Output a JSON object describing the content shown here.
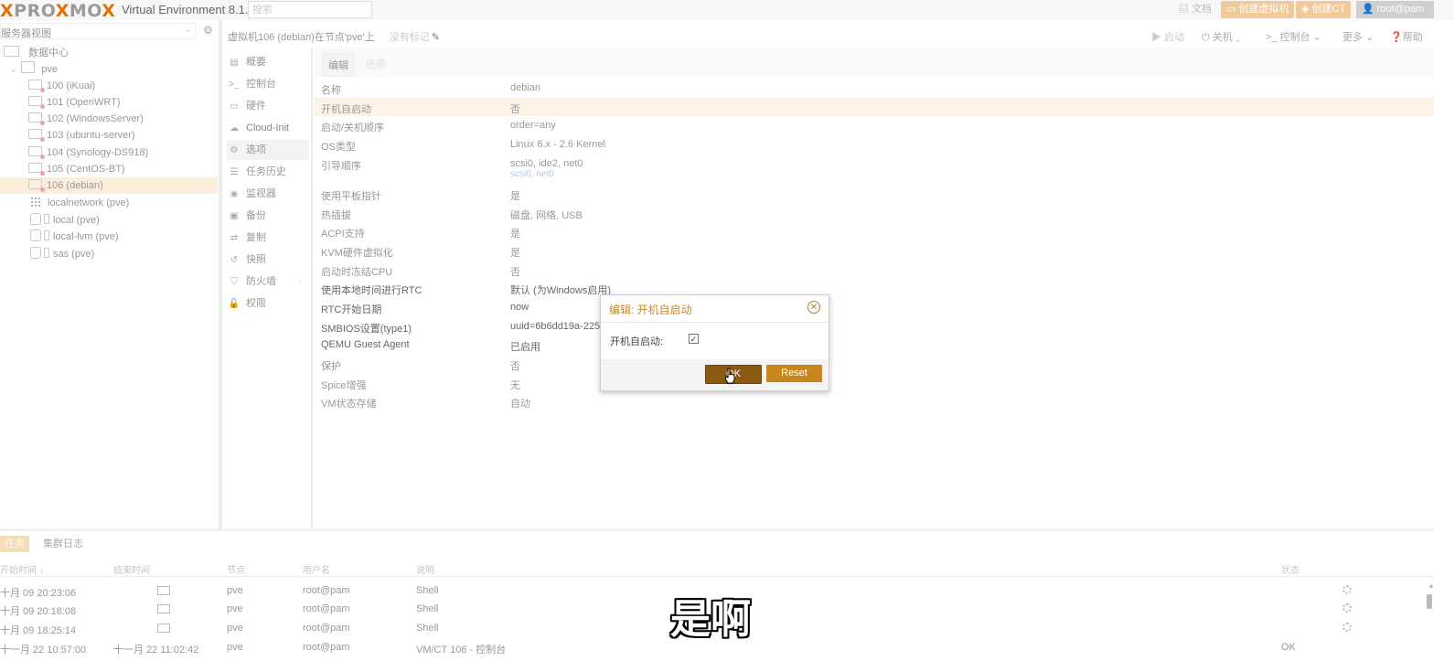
{
  "topbar": {
    "logo_a": "PRO",
    "logo_x1": "X",
    "logo_b": "MO",
    "logo_x2": "X",
    "version": "Virtual Environment 8.1.4",
    "search_placeholder": "搜索",
    "docs": "文档",
    "create_vm": "创建虚拟机",
    "create_ct": "创建CT",
    "user": "root@pam"
  },
  "tree": {
    "view": "服务器视图",
    "datacenter": "数据中心",
    "node": "pve",
    "vms": [
      "100 (iKuai)",
      "101 (OpenWRT)",
      "102 (WindowsServer)",
      "103 (ubuntu-server)",
      "104 (Synology-DS918)",
      "105 (CentOS-BT)",
      "106 (debian)"
    ],
    "network": "localnetwork (pve)",
    "storages": [
      "local (pve)",
      "local-lvm (pve)",
      "sas (pve)"
    ]
  },
  "header": {
    "title": "虚拟机106 (debian)在节点'pve'上",
    "tags": "没有标记",
    "start": "启动",
    "shutdown": "关机",
    "console": "控制台",
    "more": "更多",
    "help": "帮助"
  },
  "nav": [
    "概要",
    "控制台",
    "硬件",
    "Cloud-Init",
    "选项",
    "任务历史",
    "监视器",
    "备份",
    "复制",
    "快照",
    "防火墙",
    "权限"
  ],
  "options": {
    "edit": "编辑",
    "revert": "还原",
    "rows": [
      {
        "label": "名称",
        "value": "debian"
      },
      {
        "label": "开机自启动",
        "value": "否"
      },
      {
        "label": "启动/关机顺序",
        "value": "order=any"
      },
      {
        "label": "OS类型",
        "value": "Linux 6.x - 2.6 Kernel"
      },
      {
        "label": "引导顺序",
        "value": "scsi0, ide2, net0",
        "value2": "scsi0, net0"
      },
      {
        "label": "使用平板指针",
        "value": "是"
      },
      {
        "label": "热插拔",
        "value": "磁盘, 网络, USB"
      },
      {
        "label": "ACPI支持",
        "value": "是"
      },
      {
        "label": "KVM硬件虚拟化",
        "value": "是"
      },
      {
        "label": "启动时冻结CPU",
        "value": "否"
      },
      {
        "label": "使用本地时间进行RTC",
        "value": "默认 (为Windows启用)"
      },
      {
        "label": "RTC开始日期",
        "value": "now"
      },
      {
        "label": "SMBIOS设置(type1)",
        "value": "uuid=6b6dd19a-225c"
      },
      {
        "label": "QEMU Guest Agent",
        "value": "已启用"
      },
      {
        "label": "保护",
        "value": "否"
      },
      {
        "label": "Spice增强",
        "value": "无"
      },
      {
        "label": "VM状态存储",
        "value": "自动"
      }
    ]
  },
  "dialog": {
    "title": "编辑: 开机自启动",
    "field_label": "开机自启动:",
    "checkbox": "☑",
    "ok": "OK",
    "reset": "Reset"
  },
  "tasks": {
    "tab_tasks": "任务",
    "tab_log": "集群日志",
    "columns": [
      "开始时间 ↓",
      "结束时间",
      "节点",
      "用户名",
      "说明",
      "状态"
    ],
    "rows": [
      {
        "start": "十月 09 20:23:06",
        "end": "",
        "node": "pve",
        "user": "root@pam",
        "desc": "Shell",
        "status": ""
      },
      {
        "start": "十月 09 20:18:08",
        "end": "",
        "node": "pve",
        "user": "root@pam",
        "desc": "Shell",
        "status": ""
      },
      {
        "start": "十月 09 18:25:14",
        "end": "",
        "node": "pve",
        "user": "root@pam",
        "desc": "Shell",
        "status": ""
      },
      {
        "start": "十一月 22 10:57:00",
        "end": "十一月 22 11:02:42",
        "node": "pve",
        "user": "root@pam",
        "desc": "VM/CT 106 - 控制台",
        "status": "OK"
      }
    ]
  },
  "subtitle": "是啊",
  "colors": {
    "accent": "#e57000",
    "ok_button": "#8a5a12",
    "reset_button": "#c8861f"
  }
}
